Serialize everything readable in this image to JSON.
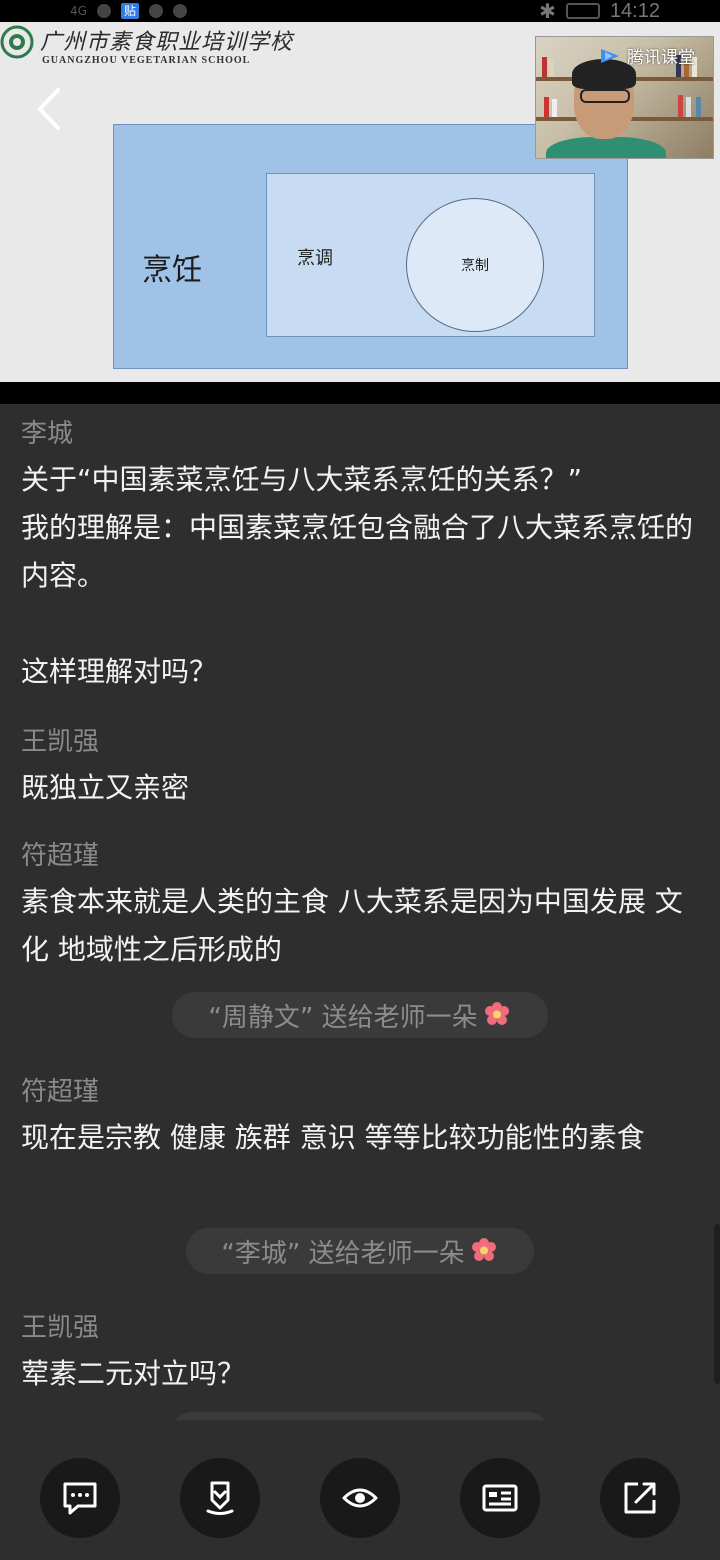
{
  "status_bar": {
    "signal": "4G",
    "badge": "贴",
    "time": "14:12"
  },
  "slide": {
    "school_name_cn": "广州市素食职业培训学校",
    "school_name_en": "GUANGZHOU VEGETARIAN SCHOOL",
    "outer_label": "烹饪",
    "inner_label": "烹调",
    "circle_label": "烹制"
  },
  "teacher_video": {
    "brand": "腾讯课堂"
  },
  "chat": {
    "messages": [
      {
        "name": "李城",
        "text": "关于“中国素菜烹饪与八大菜系烹饪的关系？”\n我的理解是：中国素菜烹饪包含融合了八大菜系烹饪的内容。\n\n这样理解对吗？"
      },
      {
        "name": "王凯强",
        "text": "既独立又亲密"
      },
      {
        "name": "符超瑾",
        "text": "素食本来就是人类的主食 八大菜系是因为中国发展 文化 地域性之后形成的"
      },
      {
        "name": "符超瑾",
        "text": "现在是宗教 健康 族群 意识 等等比较功能性的素食"
      },
      {
        "name": "王凯强",
        "text": "荤素二元对立吗？"
      }
    ],
    "gifts": [
      {
        "text": "“周静文” 送给老师一朵"
      },
      {
        "text": "“李城” 送给老师一朵"
      }
    ]
  },
  "toolbar": {
    "buttons": [
      {
        "icon": "chat-bubble-icon"
      },
      {
        "icon": "shield-icon"
      },
      {
        "icon": "eye-icon"
      },
      {
        "icon": "id-card-icon"
      },
      {
        "icon": "share-icon"
      }
    ]
  },
  "colors": {
    "background": "#2e2e2e",
    "name_text": "#8a8a8a",
    "message_text": "#f2f2f2",
    "slide_outer": "#9fc2e6",
    "slide_inner": "#c7dcf2",
    "flower": "#f06c7a"
  }
}
